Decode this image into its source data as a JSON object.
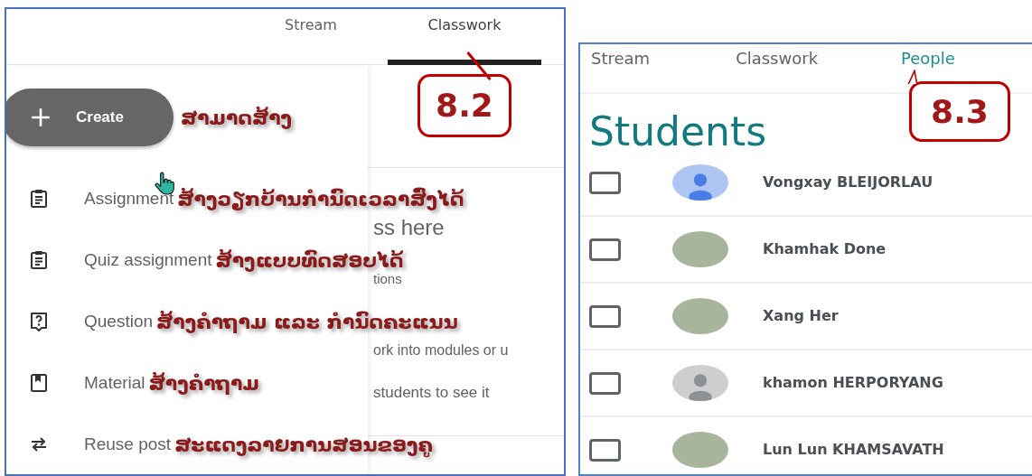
{
  "classwork_view": {
    "tabs": [
      {
        "label": "Stream",
        "selected": false
      },
      {
        "label": "Classwork",
        "selected": true
      }
    ],
    "callout": "8.2",
    "create_button": "Create",
    "create_note": "ສາມາດສ້າງ",
    "menu_items": [
      {
        "kind": "assignment",
        "label": "Assignment",
        "note": "ສ້າງວຽກບ້ານກຳນົດເວລາສົ່ງໄດ້"
      },
      {
        "kind": "quiz",
        "label": "Quiz assignment",
        "note": "ສ້າງແບບທົດສອບໄດ້"
      },
      {
        "kind": "question",
        "label": "Question",
        "note": "ສ້າງຄຳຖາມ ແລະ ກຳນົດຄະແນນ"
      },
      {
        "kind": "material",
        "label": "Material",
        "note": "ສ້າງຄຳຖາມ"
      },
      {
        "kind": "reuse",
        "label": "Reuse post",
        "note": "ສະແດງລາຍການສອນຂອງຄູ"
      }
    ],
    "background_texts": [
      "ss here",
      "tions",
      "ork into modules or u",
      "students to see it"
    ]
  },
  "people_view": {
    "tabs": [
      {
        "label": "Stream",
        "selected": false
      },
      {
        "label": "Classwork",
        "selected": false
      },
      {
        "label": "People",
        "selected": true
      }
    ],
    "callout": "8.3",
    "heading": "Students",
    "students": [
      {
        "name": "Vongxay BLEIJORLAU",
        "checked": false,
        "kind": "default",
        "color": "#4a7de6"
      },
      {
        "name": "Khamhak Done",
        "checked": false,
        "kind": "photo"
      },
      {
        "name": "Xang Her",
        "checked": false,
        "kind": "photo"
      },
      {
        "name": "khamon HERPORYANG",
        "checked": false,
        "kind": "default",
        "color": "#8e9194"
      },
      {
        "name": "Lun Lun KHAMSAVATH",
        "checked": false,
        "kind": "photo"
      }
    ]
  }
}
